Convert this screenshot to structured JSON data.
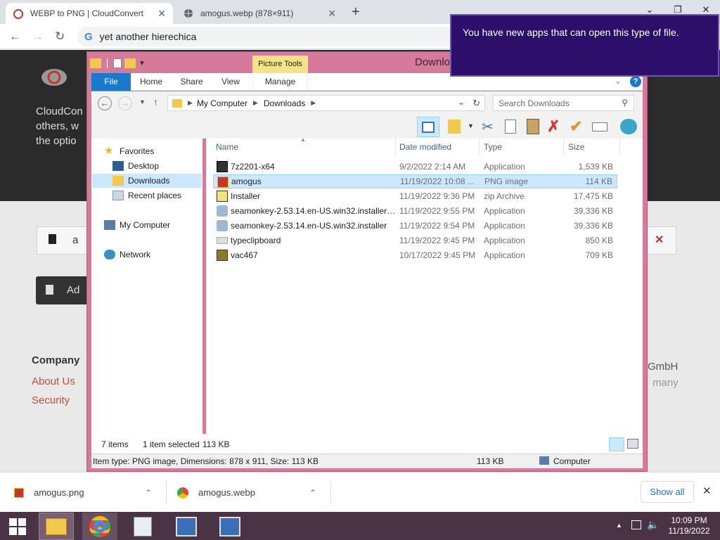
{
  "browser": {
    "tabs": [
      {
        "title": "WEBP to PNG | CloudConvert",
        "active": true
      },
      {
        "title": "amogus.webp (878×911)",
        "active": false
      }
    ],
    "address": "yet another hierechica"
  },
  "page_behind": {
    "text_lines": [
      "CloudCon",
      "others, w",
      "the optio"
    ],
    "row_text": "a",
    "add_text": "Ad",
    "company_label": "Company",
    "about_link": "About Us",
    "security_link": "Security",
    "right_line1": "GmbH",
    "right_line2": "many"
  },
  "notification": {
    "text": "You have new apps that can open this type of file."
  },
  "explorer": {
    "title": "Downlo",
    "picture_tools": "Picture Tools",
    "ribbon_tabs": [
      "File",
      "Home",
      "Share",
      "View",
      "Manage"
    ],
    "breadcrumb": [
      "My Computer",
      "Downloads"
    ],
    "search_placeholder": "Search Downloads",
    "nav": {
      "favorites": "Favorites",
      "items": [
        "Desktop",
        "Downloads",
        "Recent places"
      ],
      "computer": "My Computer",
      "network": "Network"
    },
    "columns": [
      "Name",
      "Date modified",
      "Type",
      "Size"
    ],
    "files": [
      {
        "name": "7z2201-x64",
        "date": "9/2/2022 2:14 AM",
        "type": "Application",
        "size": "1,539 KB",
        "selected": false
      },
      {
        "name": "amogus",
        "date": "11/19/2022 10:08 ...",
        "type": "PNG image",
        "size": "114 KB",
        "selected": true
      },
      {
        "name": "Installer",
        "date": "11/19/2022 9:36 PM",
        "type": "zip Archive",
        "size": "17,475 KB",
        "selected": false
      },
      {
        "name": "seamonkey-2.53.14.en-US.win32.installer ...",
        "date": "11/19/2022 9:55 PM",
        "type": "Application",
        "size": "39,336 KB",
        "selected": false
      },
      {
        "name": "seamonkey-2.53.14.en-US.win32.installer",
        "date": "11/19/2022 9:54 PM",
        "type": "Application",
        "size": "39,336 KB",
        "selected": false
      },
      {
        "name": "typeclipboard",
        "date": "11/19/2022 9:45 PM",
        "type": "Application",
        "size": "850 KB",
        "selected": false
      },
      {
        "name": "vac467",
        "date": "10/17/2022 9:45 PM",
        "type": "Application",
        "size": "709 KB",
        "selected": false
      }
    ],
    "status": {
      "items": "7 items",
      "selected": "1 item selected",
      "selected_size": "113 KB"
    },
    "details": {
      "text": "Item type: PNG image, Dimensions: 878 x 911, Size: 113 KB",
      "size": "113 KB",
      "location": "Computer"
    }
  },
  "downloads": [
    {
      "name": "amogus.png"
    },
    {
      "name": "amogus.webp"
    }
  ],
  "show_all": "Show all",
  "clock": {
    "time": "10:09 PM",
    "date": "11/19/2022"
  }
}
